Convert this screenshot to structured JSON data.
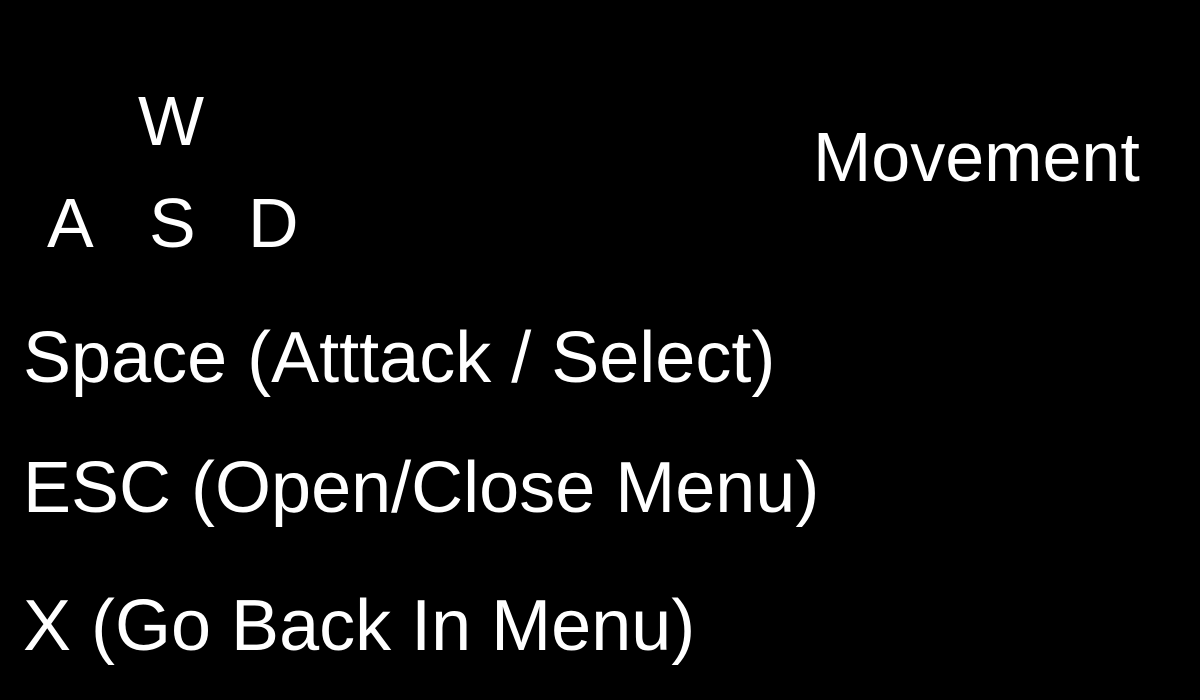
{
  "movement": {
    "keys": {
      "up": "W",
      "left": "A",
      "down": "S",
      "right": "D"
    },
    "label": "Movement"
  },
  "bindings": [
    {
      "text": "Space (Atttack / Select)"
    },
    {
      "text": "ESC (Open/Close Menu)"
    },
    {
      "text": "X (Go Back In Menu)"
    }
  ],
  "colors": {
    "background": "#000000",
    "text": "#ffffff"
  }
}
